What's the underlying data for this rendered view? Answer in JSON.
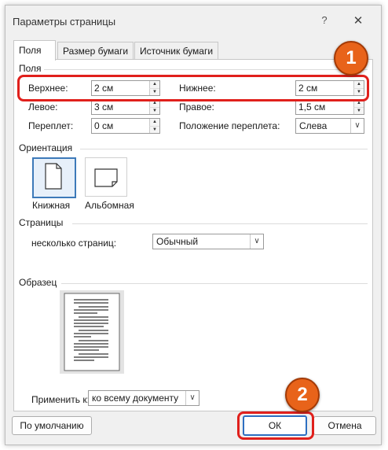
{
  "window": {
    "title": "Параметры страницы",
    "help_glyph": "?",
    "close_glyph": "✕"
  },
  "tabs": [
    {
      "label": "Поля",
      "active": true
    },
    {
      "label": "Размер бумаги",
      "active": false
    },
    {
      "label": "Источник бумаги",
      "active": false
    }
  ],
  "margins": {
    "group_title": "Поля",
    "top": {
      "label": "Верхнее:",
      "value": "2 см"
    },
    "bottom": {
      "label": "Нижнее:",
      "value": "2 см"
    },
    "left": {
      "label": "Левое:",
      "value": "3 см"
    },
    "right": {
      "label": "Правое:",
      "value": "1,5 см"
    },
    "gutter": {
      "label": "Переплет:",
      "value": "0 см"
    },
    "gutter_position": {
      "label": "Положение переплета:",
      "value": "Слева"
    }
  },
  "orientation": {
    "group_title": "Ориентация",
    "portrait_label": "Книжная",
    "landscape_label": "Альбомная",
    "selected": "portrait"
  },
  "pages": {
    "group_title": "Страницы",
    "multiple_label": "несколько страниц:",
    "multiple_value": "Обычный"
  },
  "preview": {
    "group_title": "Образец"
  },
  "apply_to": {
    "label": "Применить к:",
    "value": "ко всему документу"
  },
  "buttons": {
    "default": "По умолчанию",
    "ok": "ОК",
    "cancel": "Отмена"
  },
  "annotations": {
    "badge_1": "1",
    "badge_2": "2",
    "highlight_color": "#e0201c",
    "badge_color": "#e8631a"
  }
}
